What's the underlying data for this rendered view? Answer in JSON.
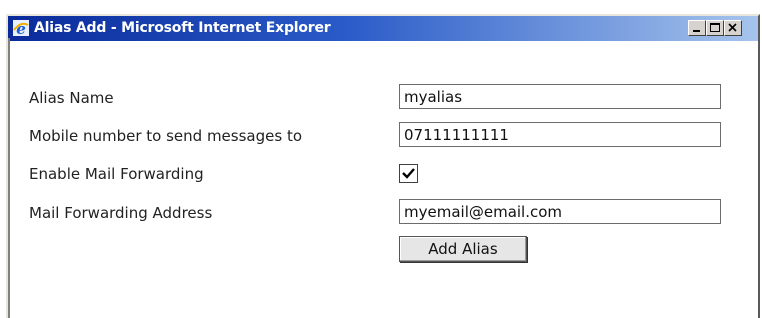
{
  "window": {
    "title": "Alias Add - Microsoft Internet Explorer"
  },
  "icons": {
    "app": "ie-icon",
    "minimize": "minimize-icon",
    "maximize": "maximize-icon",
    "close": "close-icon",
    "check": "checkmark-icon"
  },
  "form": {
    "alias_name_label": "Alias Name",
    "alias_name_value": "myalias",
    "mobile_label": "Mobile number to send messages to",
    "mobile_value": "07111111111",
    "forwarding_label": "Enable Mail Forwarding",
    "forwarding_checked": true,
    "forward_address_label": "Mail Forwarding Address",
    "forward_address_value": "myemail@email.com",
    "submit_label": "Add Alias"
  },
  "colors": {
    "titlebar_start": "#0a2a9a",
    "titlebar_end": "#a6c4ec"
  }
}
